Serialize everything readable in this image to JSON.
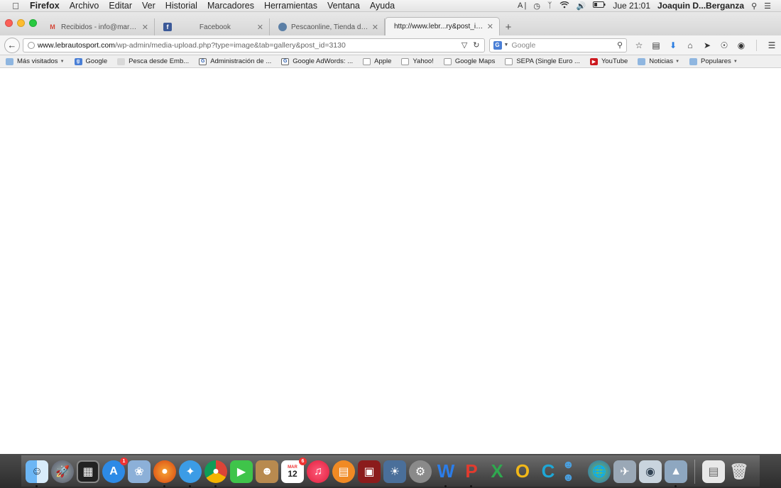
{
  "menubar": {
    "app_name": "Firefox",
    "items": [
      "Archivo",
      "Editar",
      "Ver",
      "Historial",
      "Marcadores",
      "Herramientas",
      "Ventana",
      "Ayuda"
    ],
    "clock": "Jue 21:01",
    "user": "Joaquin D...Berganza"
  },
  "tabs": [
    {
      "label": "Recibidos - info@marketing...",
      "icon": "gmail-icon",
      "color": "#d44638"
    },
    {
      "label": "Facebook",
      "icon": "facebook-icon",
      "color": "#3b5998"
    },
    {
      "label": "Pescaonline, Tienda de Pes...",
      "icon": "pescaonline-icon",
      "color": "#5b7fa6"
    },
    {
      "label": "http://www.lebr...ry&post_id=3130",
      "icon": "",
      "color": ""
    }
  ],
  "address": {
    "host": "www.lebrautosport.com",
    "path": "/wp-admin/media-upload.php?type=image&tab=gallery&post_id=3130"
  },
  "search": {
    "placeholder": "Google",
    "engine": "G"
  },
  "bookmarks": [
    {
      "label": "Más visitados",
      "icon": "folder-icon",
      "dropdown": true
    },
    {
      "label": "Google",
      "icon": "google-icon",
      "dropdown": false
    },
    {
      "label": "Pesca desde Emb...",
      "icon": "pesca-icon",
      "dropdown": false
    },
    {
      "label": "Administración de ...",
      "icon": "google-doc-icon",
      "dropdown": false
    },
    {
      "label": "Google AdWords: ...",
      "icon": "google-doc-icon",
      "dropdown": false
    },
    {
      "label": "Apple",
      "icon": "blank-page-icon",
      "dropdown": false
    },
    {
      "label": "Yahoo!",
      "icon": "blank-page-icon",
      "dropdown": false
    },
    {
      "label": "Google Maps",
      "icon": "blank-page-icon",
      "dropdown": false
    },
    {
      "label": "SEPA (Single Euro ...",
      "icon": "blank-page-icon",
      "dropdown": false
    },
    {
      "label": "YouTube",
      "icon": "youtube-icon",
      "dropdown": false
    },
    {
      "label": "Noticias",
      "icon": "folder-icon",
      "dropdown": true
    },
    {
      "label": "Populares",
      "icon": "folder-icon",
      "dropdown": true
    }
  ],
  "dock": {
    "calendar_month": "MAR",
    "calendar_day": "12",
    "app_store_badge": "1",
    "calendar_badge": "6"
  }
}
